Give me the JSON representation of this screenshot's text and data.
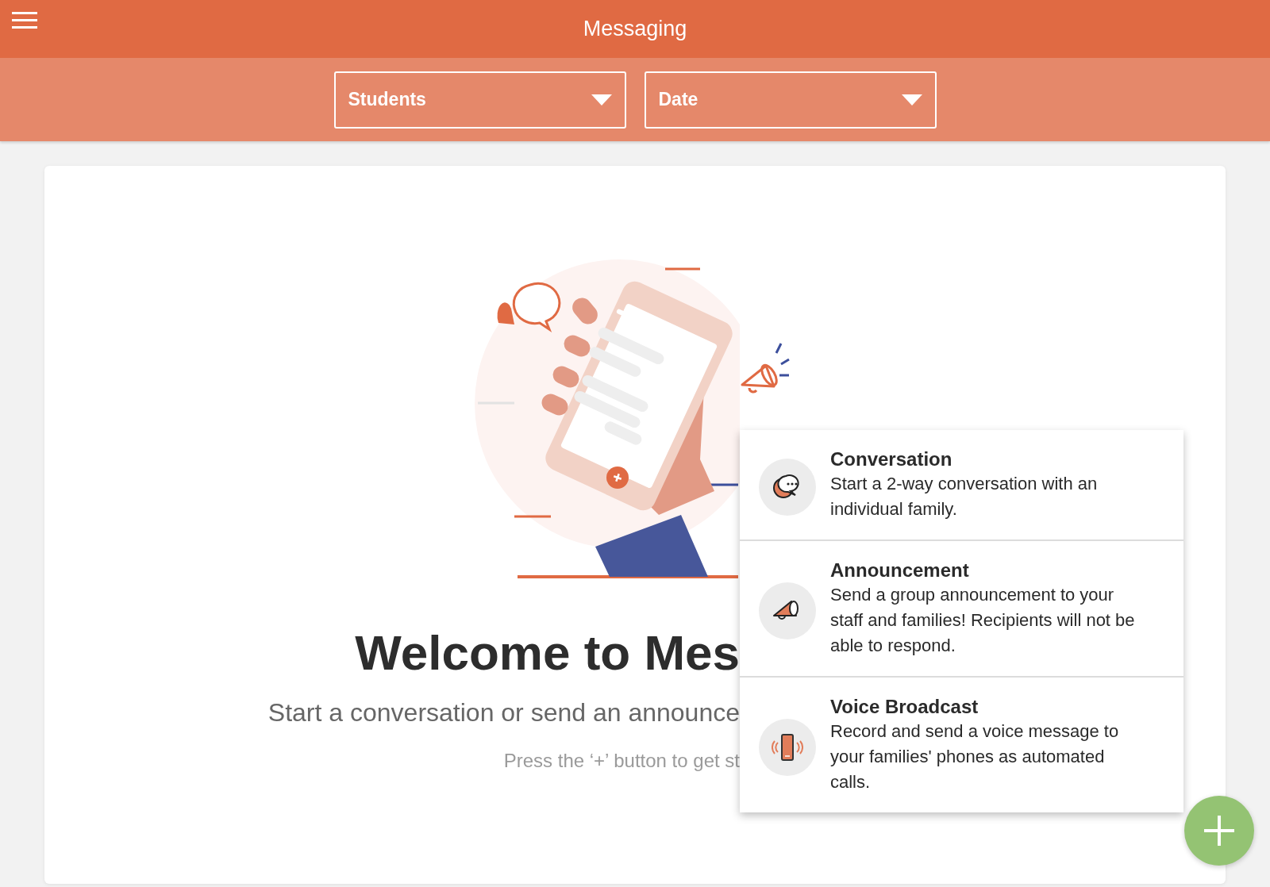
{
  "header": {
    "title": "Messaging"
  },
  "filters": [
    {
      "label": "Students"
    },
    {
      "label": "Date"
    }
  ],
  "welcome": {
    "title": "Welcome to Mes",
    "subtitle": "Start a conversation or send an announce",
    "hint": "Press the ‘+’ button to get st"
  },
  "menu": [
    {
      "kind": "conversation",
      "title": "Conversation",
      "description": "Start a 2-way conversation with an individual family."
    },
    {
      "kind": "announcement",
      "title": "Announcement",
      "description": "Send a group announcement to your staff and families! Recipients will not be able to respond."
    },
    {
      "kind": "voice",
      "title": "Voice Broadcast",
      "description": "Record and send a voice message to your families' phones as automated calls."
    }
  ]
}
